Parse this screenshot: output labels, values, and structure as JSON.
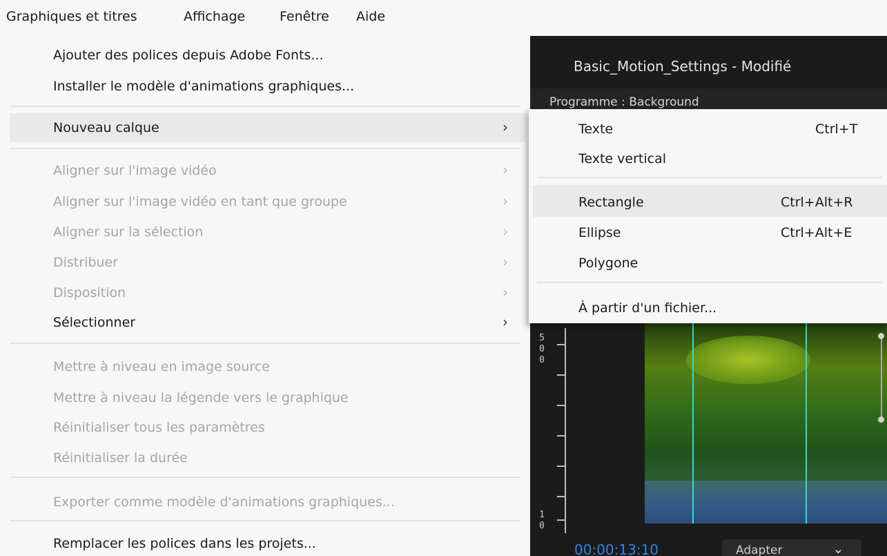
{
  "menubar": {
    "items": [
      "Graphiques et titres",
      "Affichage",
      "Fenêtre",
      "Aide"
    ]
  },
  "app": {
    "document_title": "Basic_Motion_Settings - Modifié",
    "panel_title": "Programme : Background",
    "ruler_labels": [
      "5\n0\n0",
      "1\n0"
    ],
    "timecode": "00:00:13:10",
    "fit_select": "Adapter"
  },
  "menu": {
    "items": [
      {
        "label": "Ajouter des polices depuis Adobe Fonts..."
      },
      {
        "label": "Installer le modèle d'animations graphiques..."
      },
      {
        "label": "Nouveau calque"
      },
      {
        "label": "Aligner sur l'image vidéo"
      },
      {
        "label": "Aligner sur l'image vidéo en tant que groupe"
      },
      {
        "label": "Aligner sur la sélection"
      },
      {
        "label": "Distribuer"
      },
      {
        "label": "Disposition"
      },
      {
        "label": "Sélectionner"
      },
      {
        "label": "Mettre à niveau en image source"
      },
      {
        "label": "Mettre à niveau la légende vers le graphique"
      },
      {
        "label": "Réinitialiser tous les paramètres"
      },
      {
        "label": "Réinitialiser la durée"
      },
      {
        "label": "Exporter comme modèle d'animations graphiques..."
      },
      {
        "label": "Remplacer les polices dans les projets..."
      }
    ],
    "submenu_arrow": "›"
  },
  "submenu": {
    "items": [
      {
        "label": "Texte",
        "shortcut": "Ctrl+T"
      },
      {
        "label": "Texte vertical",
        "shortcut": ""
      },
      {
        "label": "Rectangle",
        "shortcut": "Ctrl+Alt+R"
      },
      {
        "label": "Ellipse",
        "shortcut": "Ctrl+Alt+E"
      },
      {
        "label": "Polygone",
        "shortcut": ""
      },
      {
        "label": "À partir d'un fichier...",
        "shortcut": ""
      }
    ]
  }
}
